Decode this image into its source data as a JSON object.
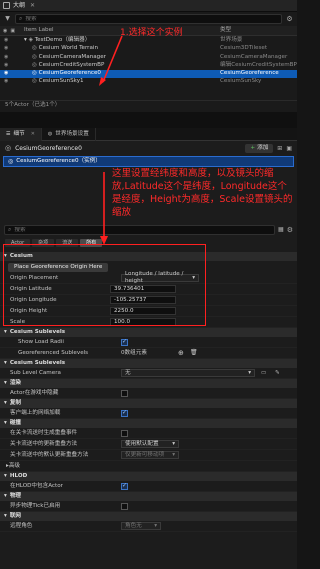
{
  "outliner": {
    "title": "大纲",
    "search_placeholder": "搜索",
    "col_label": "Item Label",
    "col_type": "类型",
    "rows": [
      {
        "name": "TestDemo（编辑器）",
        "type": "世界场景"
      },
      {
        "name": "Cesium World Terrain",
        "type": "Cesium3DTileset"
      },
      {
        "name": "CesiumCameraManager",
        "type": "CesiumCameraManager"
      },
      {
        "name": "CesiumCreditSystemBP",
        "type": "编辑CesiumCreditSystemBP"
      },
      {
        "name": "CesiumGeoreference0",
        "type": "CesiumGeoreference"
      },
      {
        "name": "CesiumSunSky1",
        "type": "CesiumSunSky"
      }
    ],
    "actor_count": "5个Actor（已选1个）"
  },
  "annotations": {
    "a1": "1.选择这个实例",
    "a2": "这里设置经纬度和高度，以及镜头的缩放,Latitude这个是纬度，Longitude这个是经度，Height为高度，Scale设置镜头的缩放"
  },
  "details": {
    "tab_details": "细节",
    "tab_world": "世界场景设置",
    "actor_name": "CesiumGeoreference0",
    "add_label": "添加",
    "component": "CesiumGeoreference0（实例）",
    "search_placeholder": "搜索",
    "filters": [
      "Actor",
      "杂项",
      "流送",
      "所有"
    ],
    "cesium_section": "Cesium",
    "place_button": "Place Georeference Origin Here",
    "props": {
      "origin_placement": {
        "label": "Origin Placement",
        "value": "Longitude / latitude / height"
      },
      "origin_latitude": {
        "label": "Origin Latitude",
        "value": "39.736401"
      },
      "origin_longitude": {
        "label": "Origin Longitude",
        "value": "-105.25737"
      },
      "origin_height": {
        "label": "Origin Height",
        "value": "2250.0"
      },
      "scale": {
        "label": "Scale",
        "value": "100.0"
      }
    },
    "sublevels_section": "Cesium Sublevels",
    "show_load_radii": "Show Load Radii",
    "georef_sublevels": "Georeferenced Sublevels",
    "georef_sublevels_value": "0数组元素",
    "sublevels_section2": "Cesium Sublevels",
    "sub_level_camera": "Sub Level Camera",
    "sub_level_camera_value": "无",
    "render_section": "渲染",
    "actor_hidden": "Actor在游戏中隐藏",
    "replication_section": "复制",
    "net_load": "客户端上的网络加载",
    "collision_section": "碰撞",
    "overlap_events": "在关卡流送时生成重叠事件",
    "update_method": "关卡流送中的更新重叠方法",
    "update_method_value": "使用默认配置",
    "default_update": "关卡流送中的默认更新重叠方法",
    "default_update_value": "仅更新可移动项",
    "advanced_section": "高级",
    "hlod_section": "HLOD",
    "include_hlod": "在HLOD中包含Actor",
    "physics_section": "物理",
    "async_tick": "异步物理Tick已启用",
    "network_section": "联网",
    "net_role": "远程角色",
    "net_role_value": "角色无"
  }
}
